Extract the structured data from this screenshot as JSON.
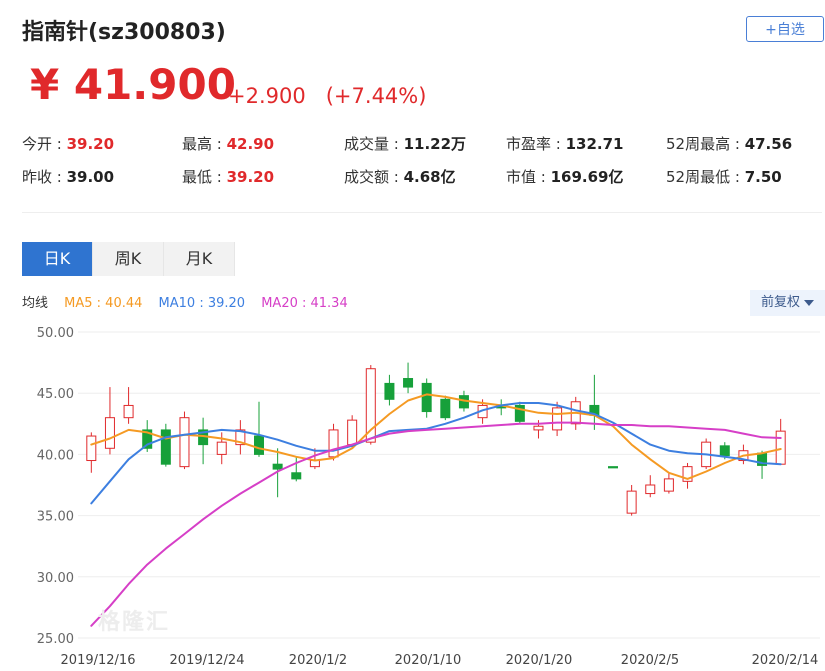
{
  "header": {
    "title": "指南针(sz300803)",
    "add_button": "+自选"
  },
  "quote": {
    "price": "¥ 41.900",
    "change": "+2.900   (+7.44%)"
  },
  "stats": [
    {
      "label": "今开 : ",
      "value": "39.20",
      "color": "#e0292b"
    },
    {
      "label": "最高 : ",
      "value": "42.90",
      "color": "#e0292b"
    },
    {
      "label": "成交量 : ",
      "value": "11.22万",
      "color": "#222222"
    },
    {
      "label": "市盈率 : ",
      "value": "132.71",
      "color": "#222222"
    },
    {
      "label": "52周最高 : ",
      "value": "47.56",
      "color": "#222222"
    },
    {
      "label": "昨收 : ",
      "value": "39.00",
      "color": "#222222"
    },
    {
      "label": "最低 : ",
      "value": "39.20",
      "color": "#e0292b"
    },
    {
      "label": "成交额 : ",
      "value": "4.68亿",
      "color": "#222222"
    },
    {
      "label": "市值 : ",
      "value": "169.69亿",
      "color": "#222222"
    },
    {
      "label": "52周最低 : ",
      "value": "7.50",
      "color": "#222222"
    }
  ],
  "tabs": [
    "日K",
    "周K",
    "月K"
  ],
  "active_tab": "日K",
  "ma_legend": {
    "label": "均线",
    "items": [
      {
        "text": "MA5 : 40.44",
        "color": "#f59a23"
      },
      {
        "text": "MA10 : 39.20",
        "color": "#3d7fe0"
      },
      {
        "text": "MA20 : 41.34",
        "color": "#d63fc7"
      }
    ]
  },
  "adjust_button": "前复权",
  "watermark": "格隆汇",
  "chart_data": {
    "type": "candlestick",
    "y_ticks": [
      "50.00",
      "45.00",
      "40.00",
      "35.00",
      "30.00",
      "25.00"
    ],
    "ylim": [
      25,
      50
    ],
    "x_ticks": [
      "2019/12/16",
      "2019/12/24",
      "2020/1/2",
      "2020/1/10",
      "2020/1/20",
      "2020/2/5",
      "2020/2/14"
    ],
    "up_color": "#e0292b",
    "down_color": "#17a03a",
    "candles": [
      {
        "o": 39.5,
        "c": 41.5,
        "h": 41.8,
        "l": 38.5
      },
      {
        "o": 40.5,
        "c": 43,
        "h": 45.5,
        "l": 40
      },
      {
        "o": 43,
        "c": 44,
        "h": 45.5,
        "l": 42.5
      },
      {
        "o": 42,
        "c": 40.5,
        "h": 42.8,
        "l": 40.2
      },
      {
        "o": 42,
        "c": 39.2,
        "h": 42.5,
        "l": 39
      },
      {
        "o": 39,
        "c": 43,
        "h": 43.5,
        "l": 38.8
      },
      {
        "o": 42,
        "c": 40.8,
        "h": 43,
        "l": 39.2
      },
      {
        "o": 40,
        "c": 41,
        "h": 41.8,
        "l": 39.2
      },
      {
        "o": 40.8,
        "c": 42,
        "h": 42.8,
        "l": 40
      },
      {
        "o": 41.5,
        "c": 40,
        "h": 44.3,
        "l": 39.8
      },
      {
        "o": 39.2,
        "c": 38.8,
        "h": 40.5,
        "l": 36.5
      },
      {
        "o": 38.5,
        "c": 38,
        "h": 39.8,
        "l": 37.8
      },
      {
        "o": 39,
        "c": 39.5,
        "h": 40.5,
        "l": 38.8
      },
      {
        "o": 39.8,
        "c": 42,
        "h": 42.5,
        "l": 39.5
      },
      {
        "o": 40.8,
        "c": 42.8,
        "h": 43.2,
        "l": 40.5
      },
      {
        "o": 41,
        "c": 47,
        "h": 47.3,
        "l": 40.8
      },
      {
        "o": 45.8,
        "c": 44.5,
        "h": 46.5,
        "l": 44
      },
      {
        "o": 46.2,
        "c": 45.5,
        "h": 47.5,
        "l": 45
      },
      {
        "o": 45.8,
        "c": 43.5,
        "h": 46.2,
        "l": 43
      },
      {
        "o": 44.5,
        "c": 43,
        "h": 44.8,
        "l": 42.8
      },
      {
        "o": 44.8,
        "c": 43.8,
        "h": 45.2,
        "l": 43.5
      },
      {
        "o": 43,
        "c": 44,
        "h": 44.5,
        "l": 42.5
      },
      {
        "o": 44,
        "c": 43.8,
        "h": 44.5,
        "l": 43.2
      },
      {
        "o": 44,
        "c": 42.7,
        "h": 44.3,
        "l": 42.5
      },
      {
        "o": 42,
        "c": 42.3,
        "h": 42.8,
        "l": 41.3
      },
      {
        "o": 42,
        "c": 43.8,
        "h": 44.3,
        "l": 41.5
      },
      {
        "o": 42.5,
        "c": 44.3,
        "h": 44.7,
        "l": 42
      },
      {
        "o": 44,
        "c": 43.2,
        "h": 46.5,
        "l": 42
      },
      {
        "o": 39,
        "c": 38.9,
        "h": 39,
        "l": 38.9
      },
      {
        "o": 35.2,
        "c": 37,
        "h": 37.5,
        "l": 35
      },
      {
        "o": 36.8,
        "c": 37.5,
        "h": 38.3,
        "l": 36.5
      },
      {
        "o": 37,
        "c": 38,
        "h": 38.5,
        "l": 36.8
      },
      {
        "o": 37.8,
        "c": 39,
        "h": 39.3,
        "l": 37.2
      },
      {
        "o": 39,
        "c": 41,
        "h": 41.3,
        "l": 38.8
      },
      {
        "o": 40.7,
        "c": 39.9,
        "h": 41,
        "l": 39.6
      },
      {
        "o": 39.5,
        "c": 40.3,
        "h": 40.8,
        "l": 39.2
      },
      {
        "o": 40.1,
        "c": 39.1,
        "h": 40.3,
        "l": 38
      },
      {
        "o": 39.2,
        "c": 41.9,
        "h": 42.9,
        "l": 39.2
      }
    ],
    "series": [
      {
        "name": "MA5",
        "color": "#f59a23",
        "values": [
          40.8,
          41.3,
          42,
          41.8,
          41.3,
          41.6,
          41.5,
          41.3,
          41,
          40.5,
          40.2,
          39.8,
          39.5,
          39.7,
          40.5,
          42,
          43.3,
          44.4,
          44.9,
          44.7,
          44.4,
          44.2,
          44,
          43.7,
          43.4,
          43.3,
          43.4,
          43.2,
          42.3,
          40.8,
          39.6,
          38.5,
          38,
          38.6,
          39.3,
          39.9,
          40.1,
          40.44
        ]
      },
      {
        "name": "MA10",
        "color": "#3d7fe0",
        "values": [
          36,
          37.8,
          39.6,
          40.8,
          41.4,
          41.6,
          41.8,
          42,
          41.9,
          41.6,
          41.2,
          40.7,
          40.3,
          40.3,
          40.7,
          41.3,
          41.9,
          42,
          42.1,
          42.5,
          43,
          43.6,
          44,
          44.2,
          44.2,
          44,
          43.6,
          43.3,
          42.6,
          41.7,
          40.8,
          40.3,
          40.1,
          40,
          39.8,
          39.6,
          39.3,
          39.2
        ]
      },
      {
        "name": "MA20",
        "color": "#d63fc7",
        "values": [
          26,
          27.6,
          29.4,
          31,
          32.3,
          33.5,
          34.7,
          35.8,
          36.8,
          37.7,
          38.6,
          39.3,
          39.9,
          40.4,
          40.8,
          41.3,
          41.7,
          41.9,
          42,
          42.1,
          42.2,
          42.3,
          42.4,
          42.5,
          42.5,
          42.6,
          42.6,
          42.5,
          42.4,
          42.4,
          42.3,
          42.3,
          42.2,
          42.1,
          42,
          41.7,
          41.4,
          41.34
        ]
      }
    ]
  }
}
